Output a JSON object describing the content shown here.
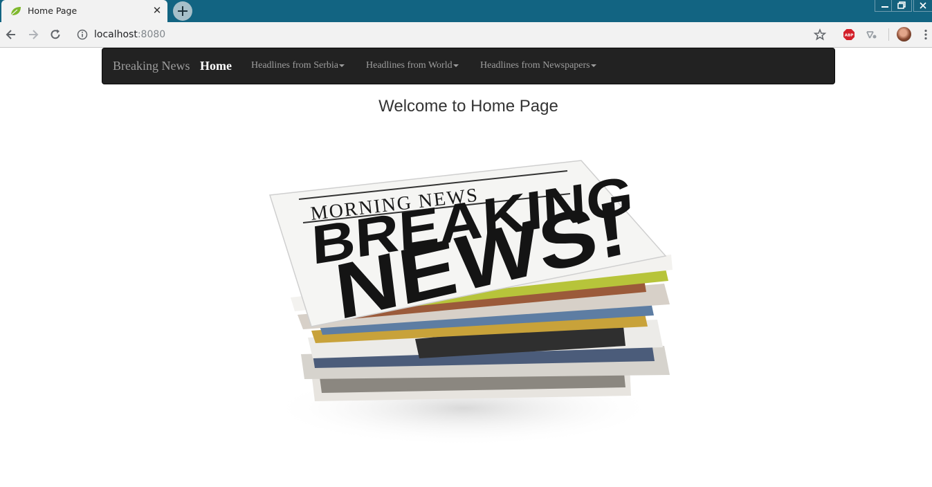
{
  "browser": {
    "tab_title": "Home Page",
    "url_host": "localhost",
    "url_port": ":8080",
    "colors": {
      "titlebar": "#126482",
      "toolbar": "#f2f2f2"
    }
  },
  "navbar": {
    "brand": "Breaking News",
    "home": "Home",
    "dropdowns": [
      {
        "label": "Headlines from Serbia"
      },
      {
        "label": "Headlines from World"
      },
      {
        "label": "Headlines from Newspapers"
      }
    ],
    "colors": {
      "background": "#222222",
      "link": "#9d9d9d",
      "active": "#ffffff"
    }
  },
  "main": {
    "heading": "Welcome to Home Page",
    "hero_image": {
      "icon": "newspaper-stack-image",
      "masthead": "MORNING NEWS",
      "headline_1": "BREAKING",
      "headline_2": "NEWS!"
    }
  }
}
